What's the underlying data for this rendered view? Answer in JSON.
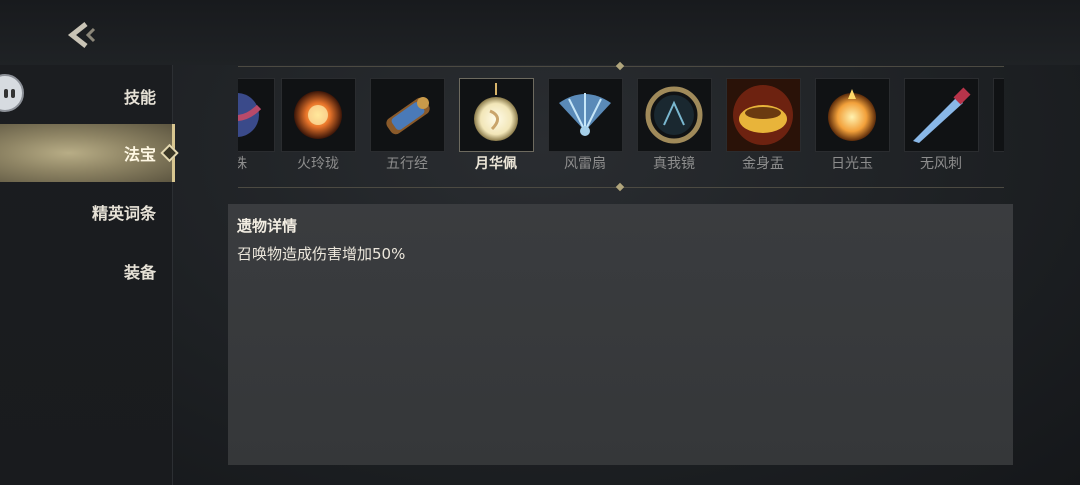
{
  "nav": {
    "back_icon": "chevron-left-icon"
  },
  "sidebar": {
    "items": [
      {
        "label": "技能",
        "active": false
      },
      {
        "label": "法宝",
        "active": true
      },
      {
        "label": "精英词条",
        "active": false
      },
      {
        "label": "装备",
        "active": false
      }
    ]
  },
  "relics": [
    {
      "name": "珠",
      "icon": "pearl-icon",
      "color": "#b84a6a"
    },
    {
      "name": "火玲珑",
      "icon": "fire-orb-icon",
      "color": "#e8742a"
    },
    {
      "name": "五行经",
      "icon": "scroll-icon",
      "color": "#4a7ab8"
    },
    {
      "name": "月华佩",
      "icon": "moon-pendant-icon",
      "color": "#f2e6b8",
      "selected": true
    },
    {
      "name": "风雷扇",
      "icon": "fan-icon",
      "color": "#8fc6e8"
    },
    {
      "name": "真我镜",
      "icon": "mirror-icon",
      "color": "#9aa6a8"
    },
    {
      "name": "金身盂",
      "icon": "golden-bowl-icon",
      "color": "#e8b43a"
    },
    {
      "name": "日光玉",
      "icon": "sun-jade-icon",
      "color": "#f2a03a"
    },
    {
      "name": "无风刺",
      "icon": "dagger-icon",
      "color": "#8ab8e8"
    }
  ],
  "detail": {
    "title": "遗物详情",
    "description": "召唤物造成伤害增加50%"
  }
}
